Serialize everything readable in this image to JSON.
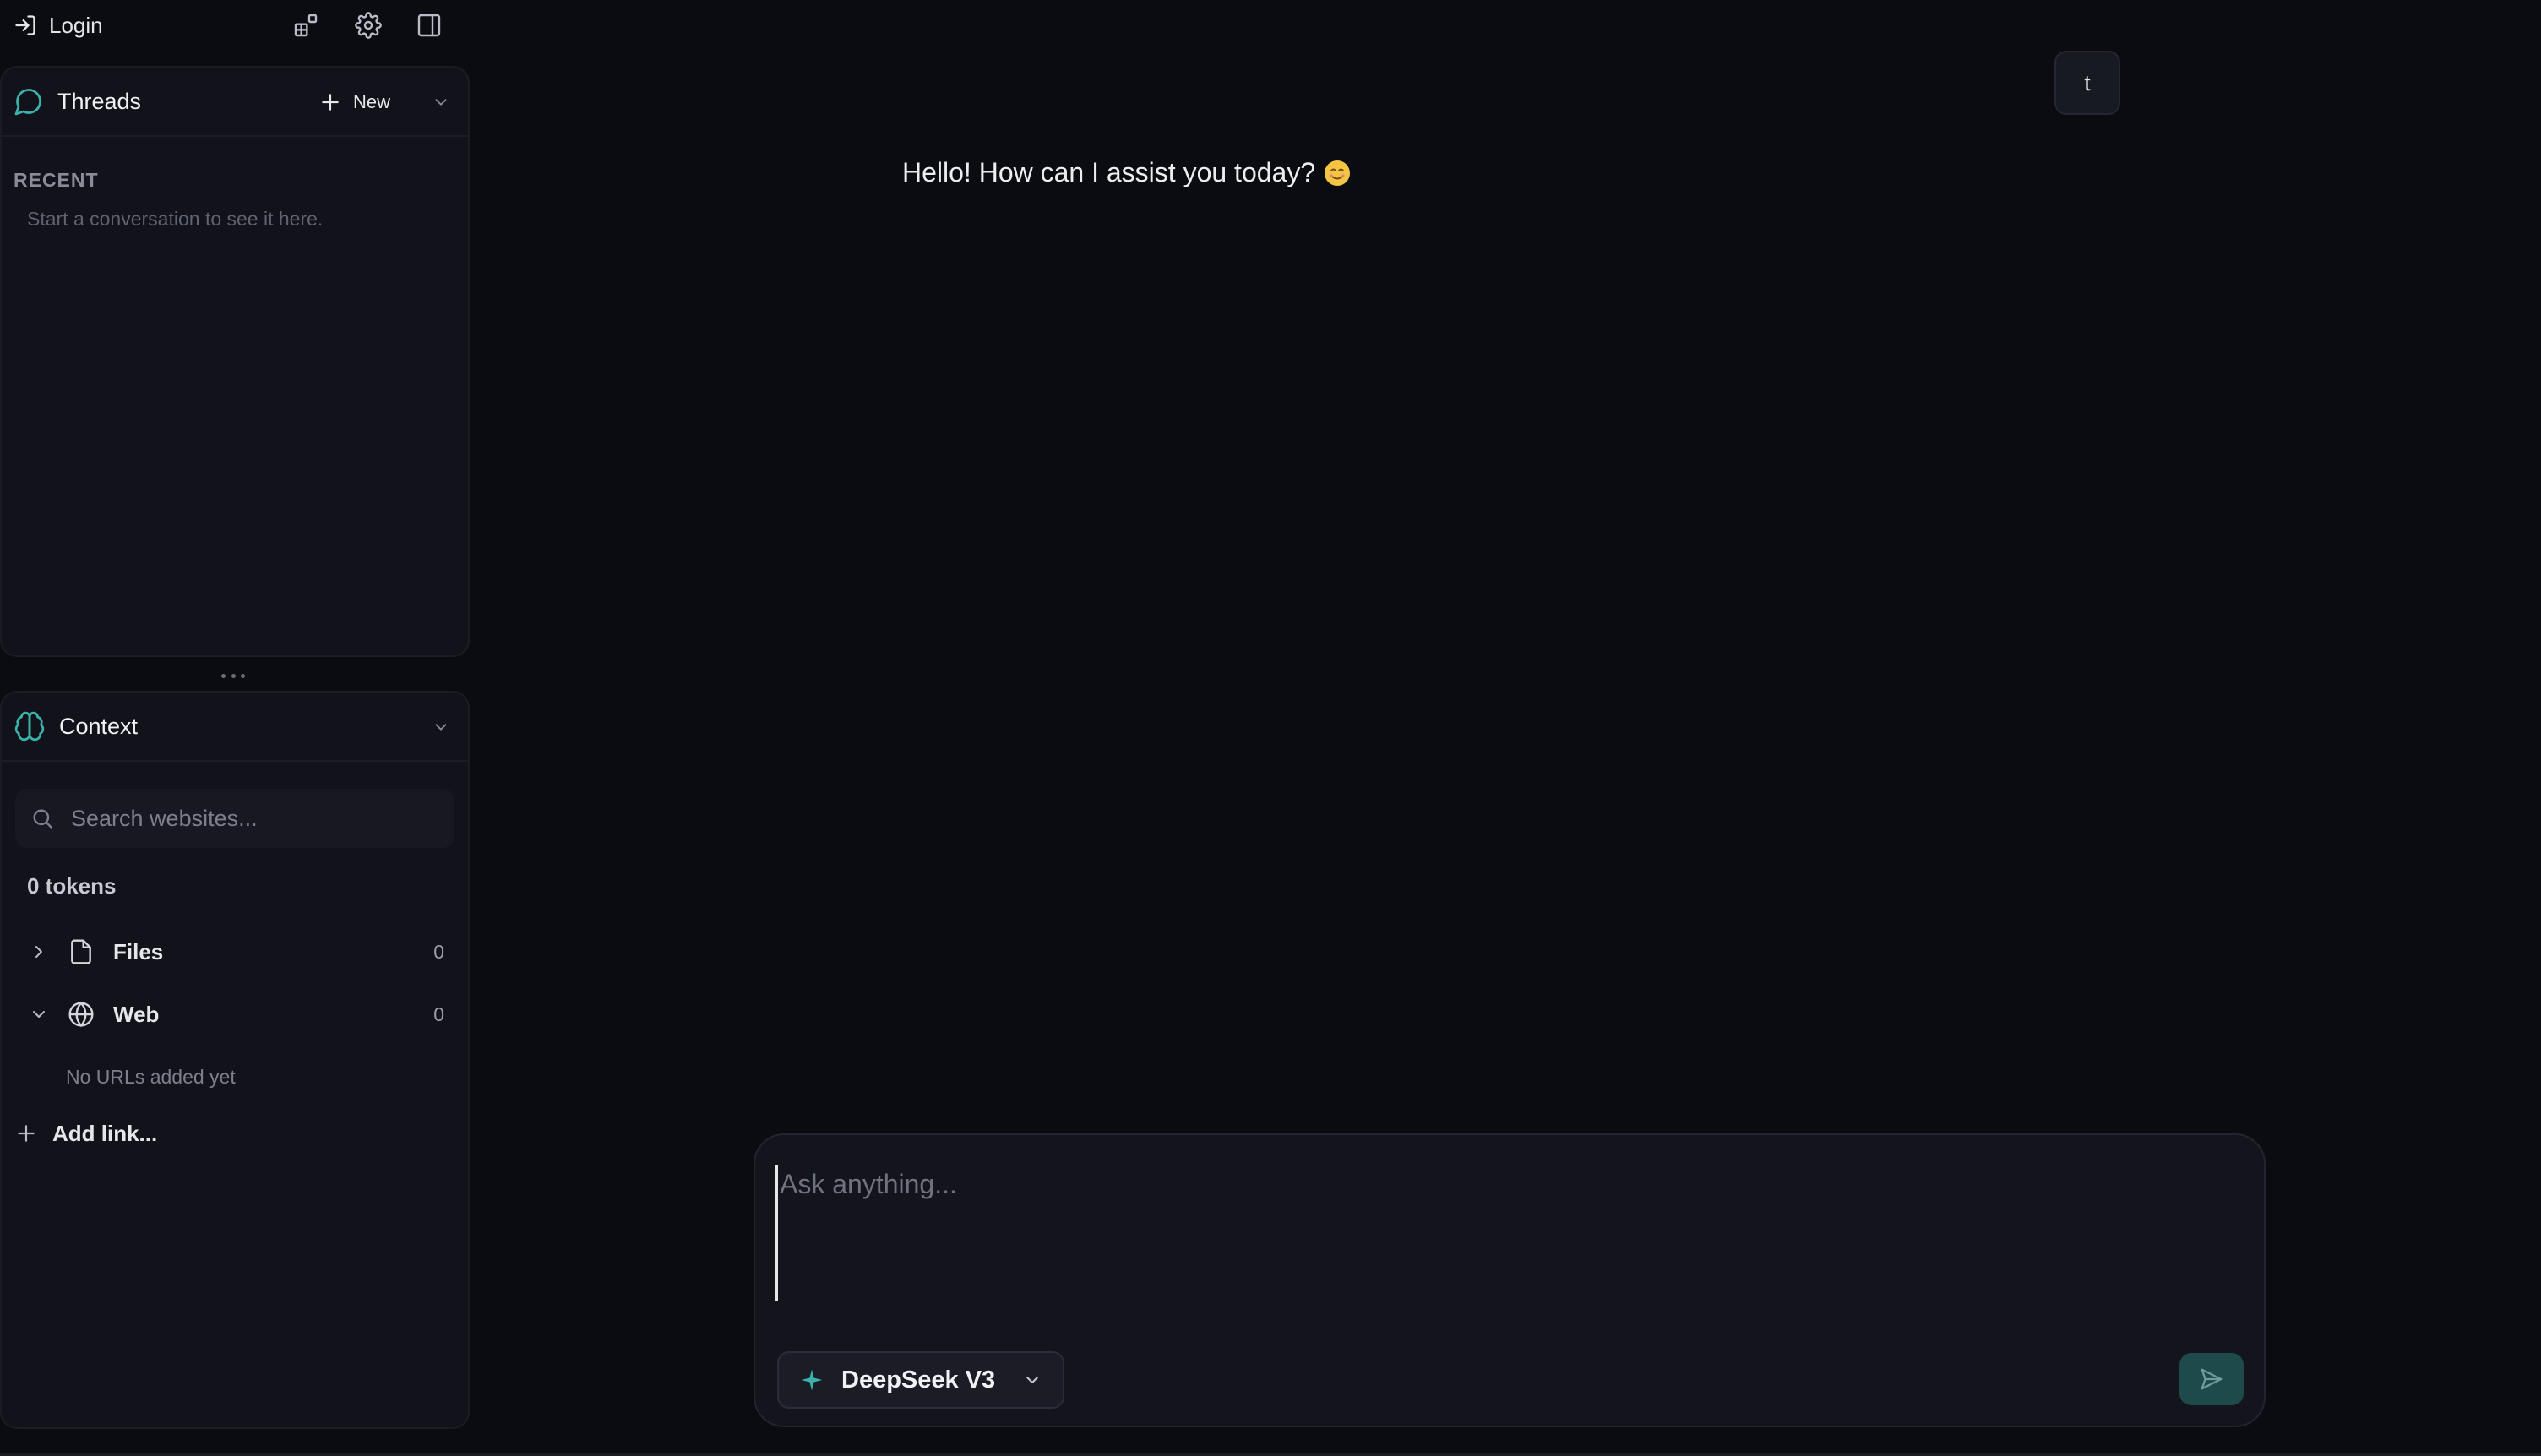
{
  "topbar": {
    "login_label": "Login",
    "icons": [
      "login-icon",
      "widgets-icon",
      "gear-icon",
      "sidebar-toggle-icon"
    ]
  },
  "threads": {
    "title": "Threads",
    "new_label": "New",
    "recent_label": "RECENT",
    "empty_text": "Start a conversation to see it here."
  },
  "context": {
    "title": "Context",
    "search_placeholder": "Search websites...",
    "tokens": "0 tokens",
    "items": [
      {
        "label": "Files",
        "count": "0",
        "expanded": false
      },
      {
        "label": "Web",
        "count": "0",
        "expanded": true
      }
    ],
    "web_empty": "No URLs added yet",
    "add_link_label": "Add link..."
  },
  "chat": {
    "user_initial": "t",
    "assistant_message": "Hello! How can I assist you today?"
  },
  "composer": {
    "placeholder": "Ask anything...",
    "value": "",
    "model": "DeepSeek V3"
  },
  "colors": {
    "background": "#0b0c11",
    "panel": "#12131a",
    "accent": "#3bb3ad",
    "send_button": "#1e4a4c"
  }
}
